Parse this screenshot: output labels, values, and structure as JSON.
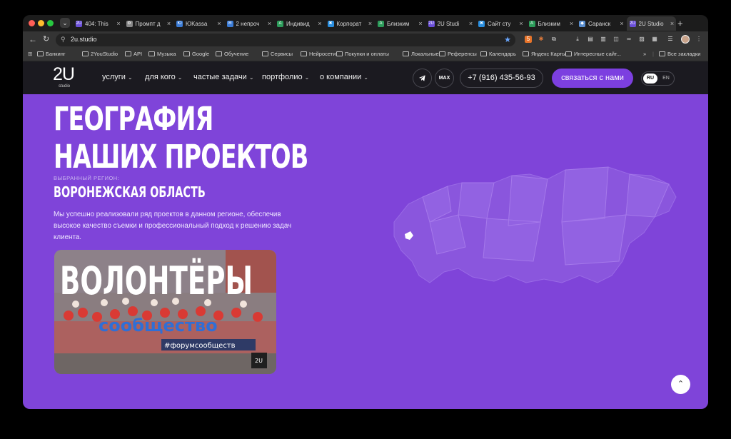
{
  "browser": {
    "tabs": [
      {
        "label": "404: This",
        "fav": "#6a4fd8",
        "fav_text": "2U"
      },
      {
        "label": "Промпт д",
        "fav": "#888888",
        "fav_text": "⚙"
      },
      {
        "label": "ЮKassa",
        "fav": "#3a7bd5",
        "fav_text": "Ю"
      },
      {
        "label": "2 непроч",
        "fav": "#3a7bd5",
        "fav_text": "✉"
      },
      {
        "label": "Индивид",
        "fav": "#2c9c5a",
        "fav_text": "A"
      },
      {
        "label": "Корпорат",
        "fav": "#2a8fe0",
        "fav_text": "✖"
      },
      {
        "label": "Близким",
        "fav": "#2c9c5a",
        "fav_text": "A"
      },
      {
        "label": "2U Studi",
        "fav": "#6a4fd8",
        "fav_text": "2U"
      },
      {
        "label": "Сайт сту",
        "fav": "#2a8fe0",
        "fav_text": "✖"
      },
      {
        "label": "Близким",
        "fav": "#2c9c5a",
        "fav_text": "A"
      },
      {
        "label": "Саранск",
        "fav": "#5a8fd0",
        "fav_text": "◆"
      },
      {
        "label": "2U Studio",
        "fav": "#6a4fd8",
        "fav_text": "2U",
        "active": true
      }
    ],
    "url": "2u.studio",
    "bookmarks": [
      "Банкинг",
      "2YouStudio",
      "API",
      "Музыка",
      "Google",
      "Обучение",
      "Сервисы",
      "Нейросети",
      "Покупки и оплаты",
      "Локальные",
      "Референсы",
      "Календарь",
      "Яндекс Карты",
      "Интересные сайт..."
    ],
    "bookmarks_more": "»",
    "all_bookmarks": "Все закладки"
  },
  "site": {
    "logo": "2U",
    "logo_sub": "studio",
    "menu": [
      "услуги",
      "для кого",
      "частые задачи",
      "портфолио",
      "о компании"
    ],
    "telegram_icon": "telegram-icon",
    "max_label": "MAX",
    "phone": "+7 (916) 435-56-93",
    "contact_button": "связаться с нами",
    "lang_ru": "RU",
    "lang_en": "EN"
  },
  "hero": {
    "title_line1": "ГЕОГРАФИЯ",
    "title_line2": "НАШИХ ПРОЕКТОВ",
    "selected_label": "ВЫБРАННЫЙ РЕГИОН:",
    "region": "ВОРОНЕЖСКАЯ ОБЛАСТЬ",
    "description": "Мы успешно реализовали ряд проектов в данном регионе, обеспечив высокое качество съемки и профессиональный подход к решению задач клиента.",
    "photo_text": "ВОЛОНТЁРЫ",
    "banner_text": "#форумсообществ",
    "community_text": "сообщество",
    "photo_badge": "2U"
  },
  "colors": {
    "accent": "#7f44d9",
    "nav_bg": "#1b1a20",
    "button": "#7c3fe0"
  }
}
